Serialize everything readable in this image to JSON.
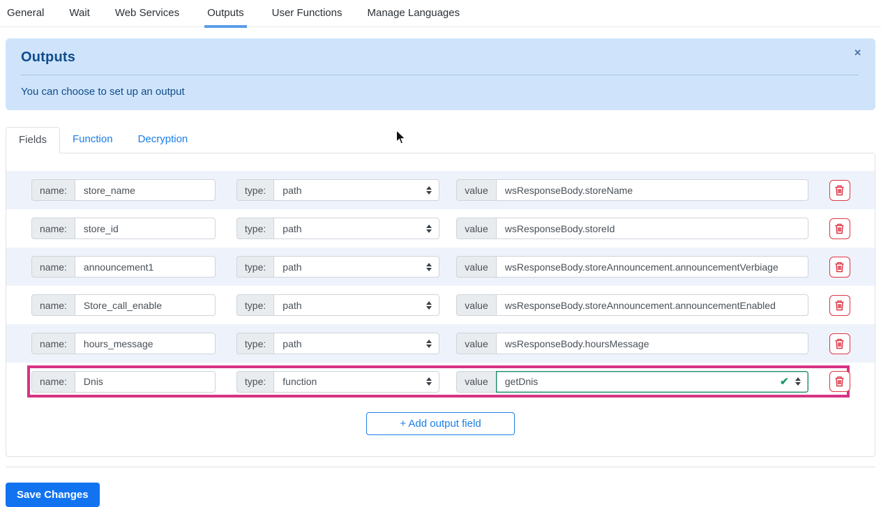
{
  "topnav": {
    "tabs": [
      {
        "label": "General",
        "active": false
      },
      {
        "label": "Wait",
        "active": false
      },
      {
        "label": "Web Services",
        "active": false
      },
      {
        "label": "Outputs",
        "active": true
      },
      {
        "label": "User Functions",
        "active": false
      },
      {
        "label": "Manage Languages",
        "active": false
      }
    ]
  },
  "alert": {
    "title": "Outputs",
    "message": "You can choose to set up an output",
    "close_label": "✕"
  },
  "subtabs": [
    {
      "label": "Fields",
      "active": true
    },
    {
      "label": "Function",
      "active": false
    },
    {
      "label": "Decryption",
      "active": false
    }
  ],
  "fields": {
    "labels": {
      "name": "name:",
      "type": "type:",
      "value": "value"
    },
    "rows": [
      {
        "name": "store_name",
        "type": "path",
        "value": "wsResponseBody.storeName",
        "highlighted": false,
        "value_is_select": false
      },
      {
        "name": "store_id",
        "type": "path",
        "value": "wsResponseBody.storeId",
        "highlighted": false,
        "value_is_select": false
      },
      {
        "name": "announcement1",
        "type": "path",
        "value": "wsResponseBody.storeAnnouncement.announcementVerbiage",
        "highlighted": false,
        "value_is_select": false
      },
      {
        "name": "Store_call_enable",
        "type": "path",
        "value": "wsResponseBody.storeAnnouncement.announcementEnabled",
        "highlighted": false,
        "value_is_select": false
      },
      {
        "name": "hours_message",
        "type": "path",
        "value": "wsResponseBody.hoursMessage",
        "highlighted": false,
        "value_is_select": false
      },
      {
        "name": "Dnis",
        "type": "function",
        "value": "getDnis",
        "highlighted": true,
        "value_is_select": true,
        "valid": true
      }
    ],
    "add_button_label": "+ Add output field"
  },
  "save_button_label": "Save Changes",
  "colors": {
    "accent_blue": "#1a7ee8",
    "tab_underline": "#5b9ce8",
    "alert_bg": "#cfe4fb",
    "alert_text": "#0f4c8c",
    "row_stripe": "#eef3fb",
    "highlight_pink": "#d63384",
    "danger_red": "#dc3545",
    "valid_green": "#1d8a66",
    "save_bg": "#1173f0"
  }
}
